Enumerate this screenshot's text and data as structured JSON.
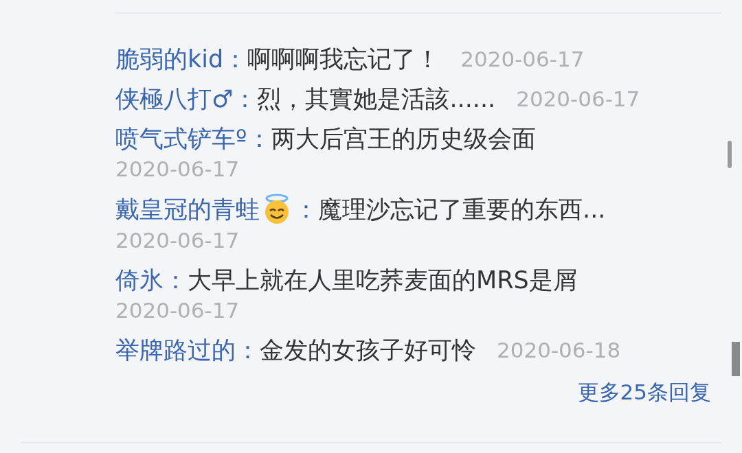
{
  "comments": [
    {
      "user": "脆弱的kid",
      "colon": "：",
      "text": "啊啊啊我忘记了！",
      "date": "2020-06-17"
    },
    {
      "user": "侠極八打♂",
      "colon": "：",
      "text": "烈，其實她是活該......",
      "date": "2020-06-17"
    },
    {
      "user": "喷气式铲车º",
      "colon": "：",
      "text": "两大后宫王的历史级会面",
      "date": "2020-06-17"
    },
    {
      "user": "戴皇冠的青蛙",
      "has_badge": true,
      "colon": "：",
      "text": "魔理沙忘记了重要的东西...",
      "date": "2020-06-17"
    },
    {
      "user": "倚氷",
      "colon": "：",
      "text": "大早上就在人里吃荞麦面的MRS是屑",
      "date": "2020-06-17"
    },
    {
      "user": "举牌路过的",
      "colon": "：",
      "text": "金发的女孩子好可怜",
      "date": "2020-06-18"
    }
  ],
  "more_replies": "更多25条回复"
}
